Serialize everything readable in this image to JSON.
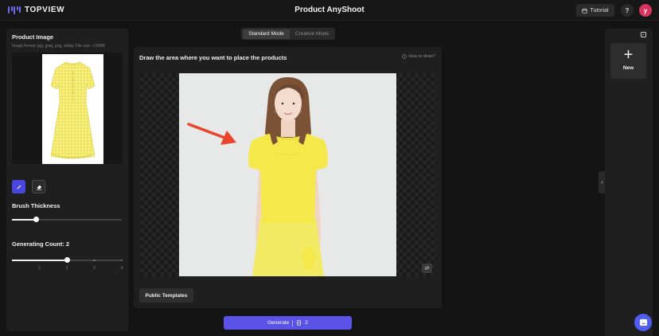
{
  "app": {
    "logo_text": "TOPVIEW",
    "title": "Product AnyShoot"
  },
  "header": {
    "tutorial_label": "Tutorial",
    "help_label": "?",
    "avatar_initial": "y"
  },
  "left_panel": {
    "title": "Product Image",
    "hint": "Image format: jpg, jpeg, png, webp; File size: <10MB",
    "brush_thickness_label": "Brush Thickness",
    "brush_thickness_level": 0.22,
    "generating_count_label": "Generating Count: 2",
    "generating_count": 2,
    "count_ticks": [
      "1",
      "2",
      "3",
      "4"
    ]
  },
  "modes": {
    "standard": "Standard Mode",
    "creative": "Creative Mode",
    "selected": "Standard Mode"
  },
  "canvas": {
    "instruction": "Draw the area where you want to place the products",
    "how_to": "How to draw?",
    "public_templates_label": "Public Templates"
  },
  "generate": {
    "label": "Generate",
    "credits": "2"
  },
  "right_panel": {
    "new_label": "New",
    "new_symbol": "+"
  },
  "colors": {
    "accent": "#5b52e8",
    "mask": "#f5e84a",
    "arrow": "#e8452c",
    "avatar": "#d8345f"
  },
  "icons": [
    "logo-icon",
    "calendar-icon",
    "help-icon",
    "swap-icon",
    "brush-icon",
    "eraser-icon",
    "info-icon",
    "coin-icon",
    "select-icon",
    "chevron-left-icon",
    "chat-icon"
  ]
}
